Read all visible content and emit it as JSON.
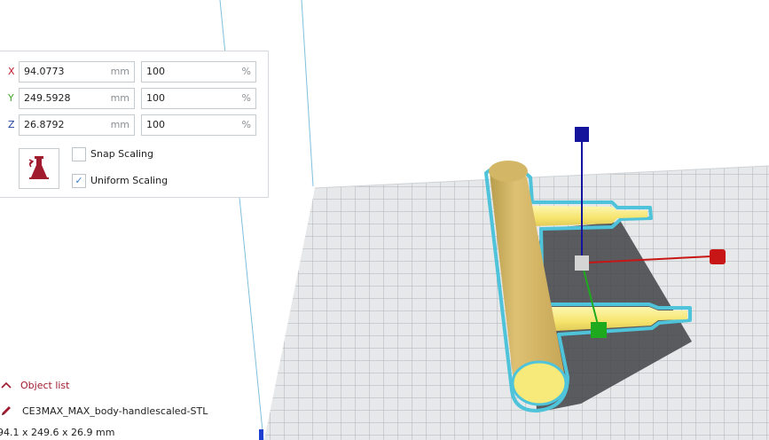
{
  "scale_tool": {
    "rows": [
      {
        "axis": "X",
        "axis_color": "#c0202b",
        "mm": "94.0773",
        "mm_unit": "mm",
        "percent": "100",
        "percent_unit": "%"
      },
      {
        "axis": "Y",
        "axis_color": "#45a02a",
        "mm": "249.5928",
        "mm_unit": "mm",
        "percent": "100",
        "percent_unit": "%"
      },
      {
        "axis": "Z",
        "axis_color": "#1f3f9a",
        "mm": "26.8792",
        "mm_unit": "mm",
        "percent": "100",
        "percent_unit": "%"
      }
    ],
    "reset_icon": "lab-flask-icon",
    "snap_scaling": {
      "label": "Snap Scaling",
      "checked": false
    },
    "uniform_scaling": {
      "label": "Uniform Scaling",
      "checked": true,
      "check_mark": "✓"
    }
  },
  "object_list": {
    "toggle_label": "Object list",
    "item_name": "CE3MAX_MAX_body-handlescaled-STL",
    "item_icon": "pencil-icon",
    "dimensions": "94.1 x 249.6 x 26.9 mm"
  },
  "colors": {
    "model_yellow": "#f4e671",
    "model_outline": "#4fc3d9",
    "axis_x": "#c81616",
    "axis_y": "#1fa91f",
    "axis_z": "#14149c",
    "accent": "#a01b2e"
  }
}
